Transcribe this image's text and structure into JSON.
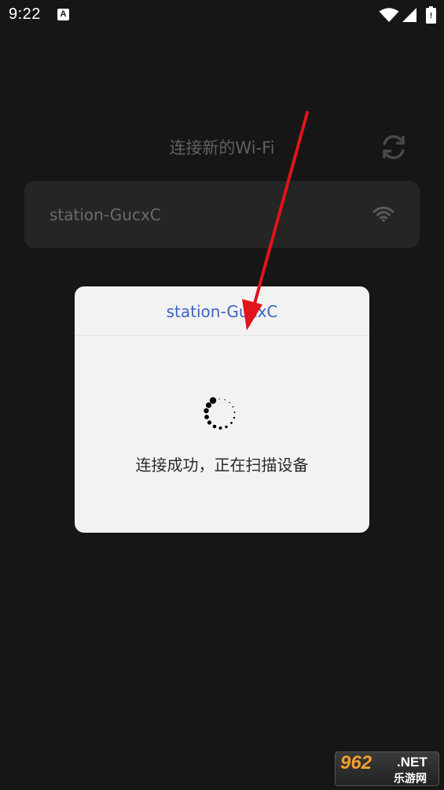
{
  "status_bar": {
    "time": "9:22",
    "app_icon_letter": "A"
  },
  "page": {
    "title": "连接新的Wi-Fi",
    "networks": [
      {
        "name": "station-GucxC"
      }
    ]
  },
  "dialog": {
    "title": "station-GucxC",
    "message": "连接成功，正在扫描设备"
  },
  "watermark": {
    "number": "962",
    "suffix": ".NET",
    "site_name": "乐游网"
  },
  "colors": {
    "background": "#161616",
    "card": "#252525",
    "dialog_bg": "#f2f2f2",
    "dialog_title": "#3e63c5",
    "arrow": "#e0141a"
  }
}
